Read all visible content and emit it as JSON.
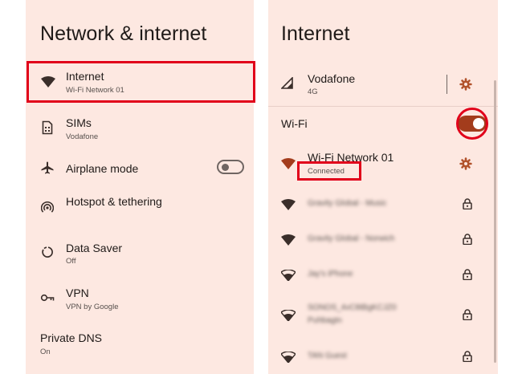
{
  "left": {
    "title": "Network & internet",
    "items": [
      {
        "label": "Internet",
        "sub": "Wi-Fi Network 01",
        "icon": "wifi-icon"
      },
      {
        "label": "SIMs",
        "sub": "Vodafone",
        "icon": "sim-card-icon"
      },
      {
        "label": "Airplane mode",
        "icon": "airplane-icon",
        "toggle": "off"
      },
      {
        "label": "Hotspot & tethering",
        "icon": "hotspot-icon"
      },
      {
        "label": "Data Saver",
        "sub": "Off",
        "icon": "data-saver-icon"
      },
      {
        "label": "VPN",
        "sub": "VPN by Google",
        "icon": "vpn-key-icon"
      },
      {
        "label": "Private DNS",
        "sub": "On"
      }
    ]
  },
  "right": {
    "title": "Internet",
    "carrier": {
      "label": "Vodafone",
      "sub": "4G",
      "icon": "cell-signal-icon"
    },
    "wifi_label": "Wi-Fi",
    "wifi_toggle": "on",
    "connected": {
      "label": "Wi-Fi Network 01",
      "sub": "Connected"
    },
    "networks": [
      {
        "label": "Gravity Global - Music",
        "locked": true
      },
      {
        "label": "Gravity Global - Norwich",
        "locked": true
      },
      {
        "label": "Jay's iPhone",
        "locked": true
      },
      {
        "label": "SONOS_4vC8tBgKCJZ0",
        "label2": "Puhbagtn",
        "locked": true
      },
      {
        "label": "TAN Guest",
        "locked": true
      }
    ]
  },
  "colors": {
    "panel_bg": "#fde8e1",
    "accent": "#a33c1c",
    "highlight": "#e1001a",
    "text": "#1f1a18"
  }
}
